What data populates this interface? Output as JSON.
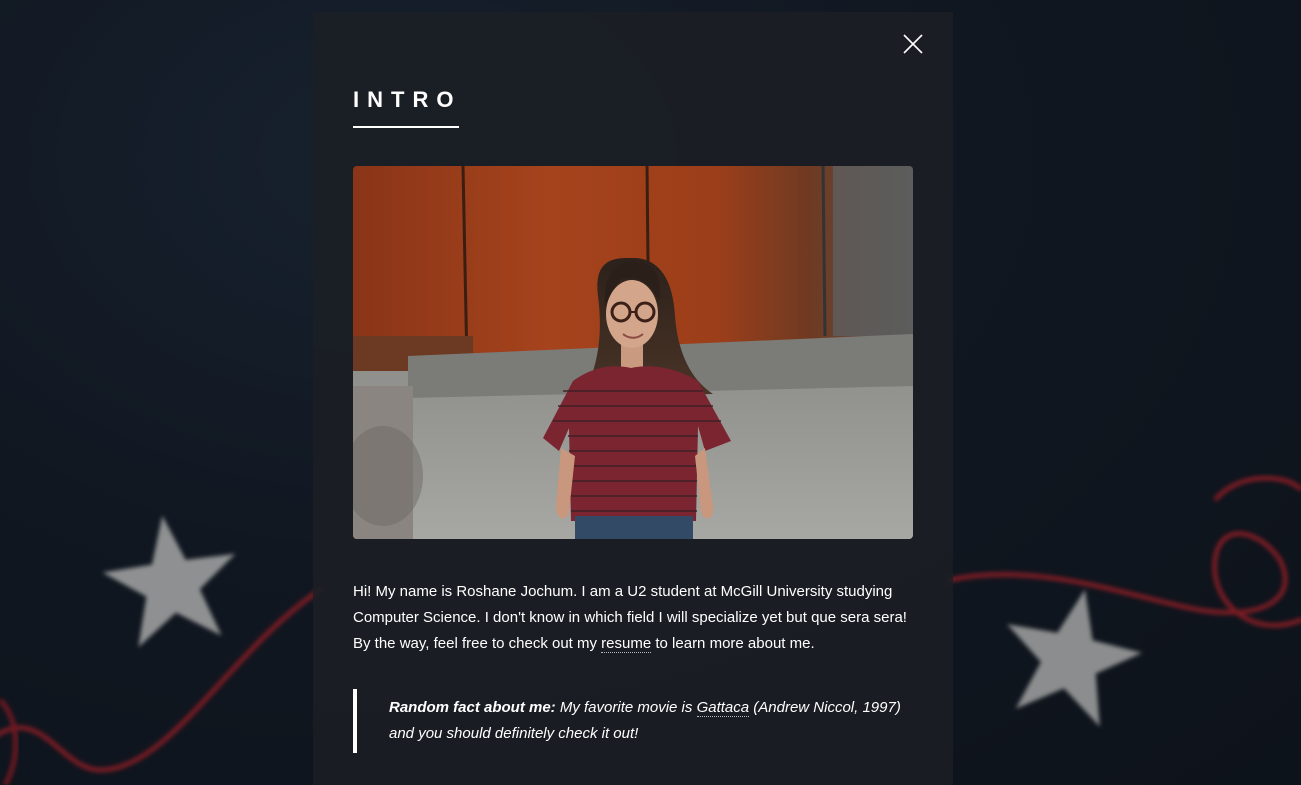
{
  "modal": {
    "heading": "Intro",
    "close_label": "Close",
    "photo_alt": "Portrait photo of Roshane Jochum"
  },
  "intro": {
    "text_before_link": "Hi! My name is Roshane Jochum. I am a U2 student at McGill University studying Computer Science. I don't know in which field I will specialize yet but que sera sera! By the way, feel free to check out my ",
    "resume_link": "resume",
    "text_after_link": " to learn more about me."
  },
  "fact": {
    "label": "Random fact about me:",
    "text_before_link": " My favorite movie is ",
    "movie_link": "Gattaca",
    "text_after_link": " (Andrew Niccol, 1997) and you should definitely check it out!"
  },
  "icons": {
    "close": "close-icon"
  },
  "colors": {
    "panel": "#1b1f24",
    "text": "#ffffff",
    "background": "#141b27",
    "string": "#b3202a",
    "star": "#d8d8d8"
  }
}
